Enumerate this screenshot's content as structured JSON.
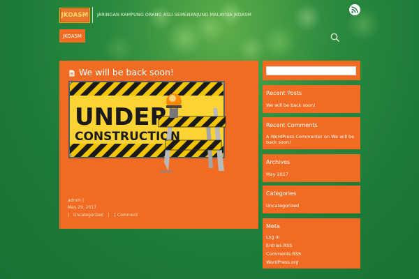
{
  "site": {
    "logo_text": "JKOASM",
    "tagline": "JARINGAN KAMPUNG ORANG ASLI SEMENANJUNG MALAYSIA JKOASM"
  },
  "icons": {
    "rss": "rss-icon",
    "search": "search-icon",
    "post_format": "document-icon"
  },
  "nav": {
    "items": [
      {
        "label": "JKOASM"
      }
    ]
  },
  "post": {
    "title": "We will be back soon!",
    "image_text_line1": "UNDER",
    "image_text_line2": "CONSTRUCTION",
    "author": "admin",
    "date": "May 29, 2017",
    "separator": "|",
    "category": "Uncategorized",
    "comments": "1 Comment"
  },
  "sidebar": {
    "recent_posts": {
      "title": "Recent Posts",
      "items": [
        "We will be back soon!"
      ]
    },
    "recent_comments": {
      "title": "Recent Comments",
      "line1": "A WordPress Commenter on We will be",
      "line2": "back soon!"
    },
    "archives": {
      "title": "Archives",
      "items": [
        "May 2017"
      ]
    },
    "categories": {
      "title": "Categories",
      "items": [
        "Uncategorized"
      ]
    },
    "meta": {
      "title": "Meta",
      "items": [
        "Log in",
        "Entries RSS",
        "Comments RSS",
        "WordPress.org"
      ]
    }
  },
  "colors": {
    "background": "#1d7a3a",
    "accent": "#f26b22",
    "text_light": "#ffffff"
  }
}
